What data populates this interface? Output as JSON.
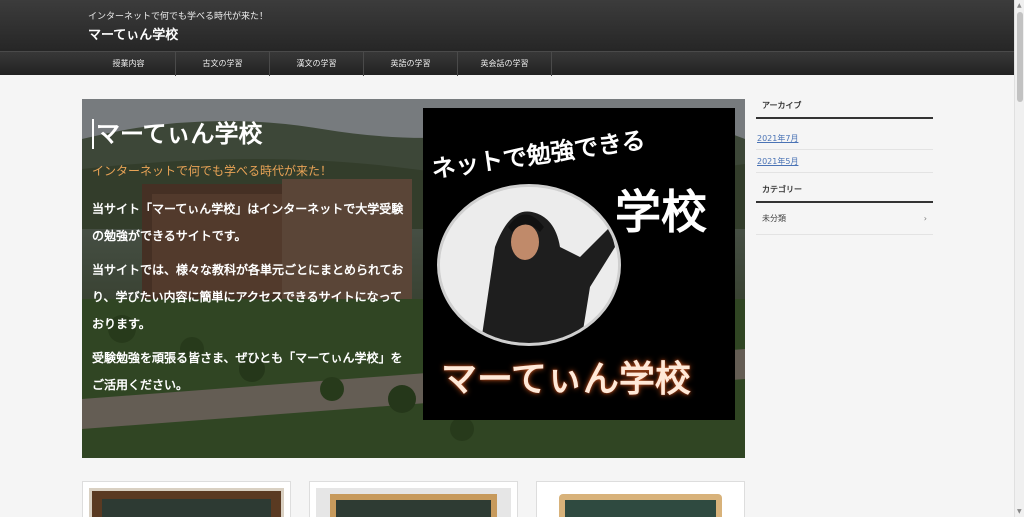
{
  "header": {
    "tagline": "インターネットで何でも学べる時代が来た！",
    "site_title": "マーてぃん学校"
  },
  "nav": {
    "items": [
      "授業内容",
      "古文の学習",
      "漢文の学習",
      "英語の学習",
      "英会話の学習"
    ]
  },
  "hero": {
    "title": "マーてぃん学校",
    "subtitle": "インターネットで何でも学べる時代が来た！",
    "paragraphs": [
      "当サイト「マーてぃん学校」はインターネットで大学受験の勉強ができるサイトです。",
      "当サイトでは、様々な教科が各単元ごとにまとめられており、学びたい内容に簡単にアクセスできるサイトになっております。",
      "受験勉強を頑張る皆さま、ぜひとも「マーてぃん学校」をご活用ください。"
    ],
    "promo": {
      "top_text": "ネットで勉強できる",
      "school_text": "学校",
      "bottom_text": "マーてぃん学校"
    }
  },
  "sidebar": {
    "archive_title": "アーカイブ",
    "archive_links": [
      "2021年7月",
      "2021年5月"
    ],
    "category_title": "カテゴリー",
    "categories": [
      "未分類"
    ],
    "category_arrow": "›"
  },
  "colors": {
    "header_bg": "#2e2e2e",
    "accent_orange": "#e8a356",
    "link_blue": "#4a73b5"
  }
}
